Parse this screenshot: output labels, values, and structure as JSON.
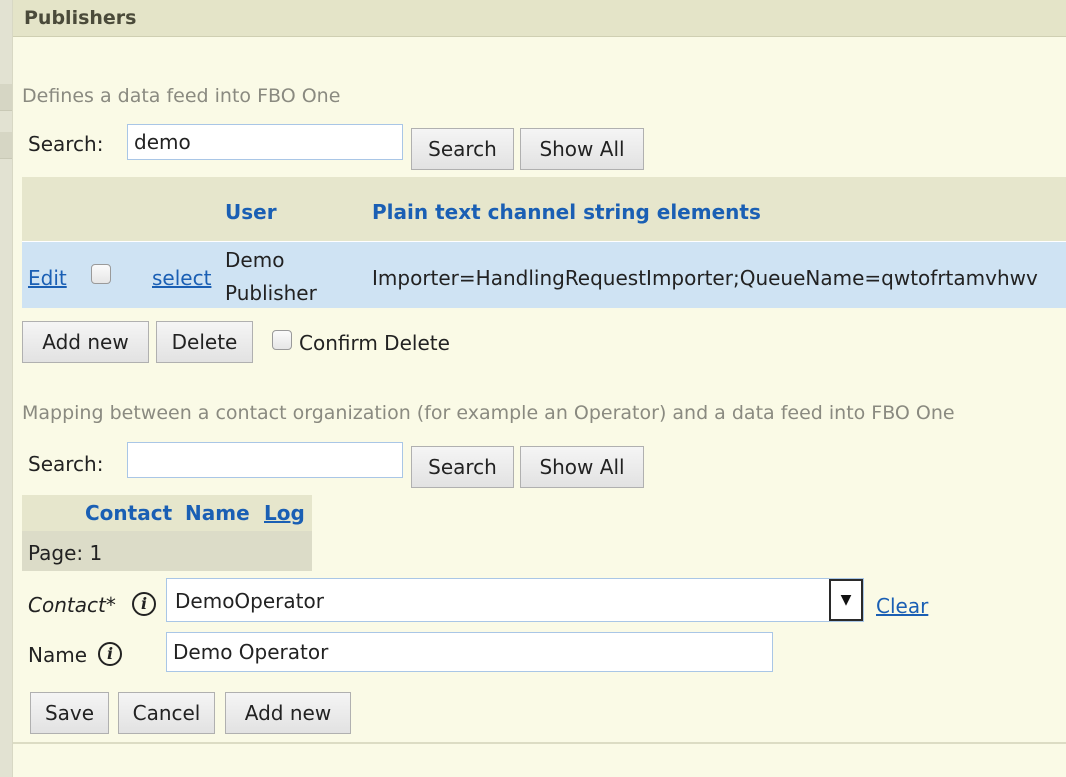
{
  "header": {
    "title": "Publishers"
  },
  "publishers": {
    "description": "Defines a data feed into FBO One",
    "search_label": "Search:",
    "search_value": "demo",
    "search_button": "Search",
    "show_all_button": "Show All",
    "columns": [
      "User",
      "Plain text channel string elements"
    ],
    "rows": [
      {
        "edit_link": "Edit",
        "select_link": "select",
        "user_line1": "Demo",
        "user_line2": "Publisher",
        "channel_string": "Importer=HandlingRequestImporter;QueueName=qwtofrtamvhwv"
      }
    ],
    "add_new_button": "Add new",
    "delete_button": "Delete",
    "confirm_delete_label": "Confirm Delete"
  },
  "mapping": {
    "description": "Mapping between a contact organization (for example an Operator) and a data feed into FBO One",
    "search_label": "Search:",
    "search_value": "",
    "search_button": "Search",
    "show_all_button": "Show All",
    "columns": [
      "Contact",
      "Name",
      "Log"
    ],
    "pager_text": "Page: 1",
    "contact_label": "Contact*",
    "contact_value": "DemoOperator",
    "clear_link": "Clear",
    "name_label": "Name",
    "name_value": "Demo Operator",
    "save_button": "Save",
    "cancel_button": "Cancel",
    "add_new_button": "Add new"
  },
  "icons": {
    "info": "info-icon",
    "dropdown": "triangle-down-icon",
    "checkbox": "checkbox-icon"
  },
  "colors": {
    "link": "#1a5fb4",
    "header_bg": "#e4e4c8",
    "selected_row_bg": "#cfe3f3",
    "page_bg": "#fafae6"
  }
}
